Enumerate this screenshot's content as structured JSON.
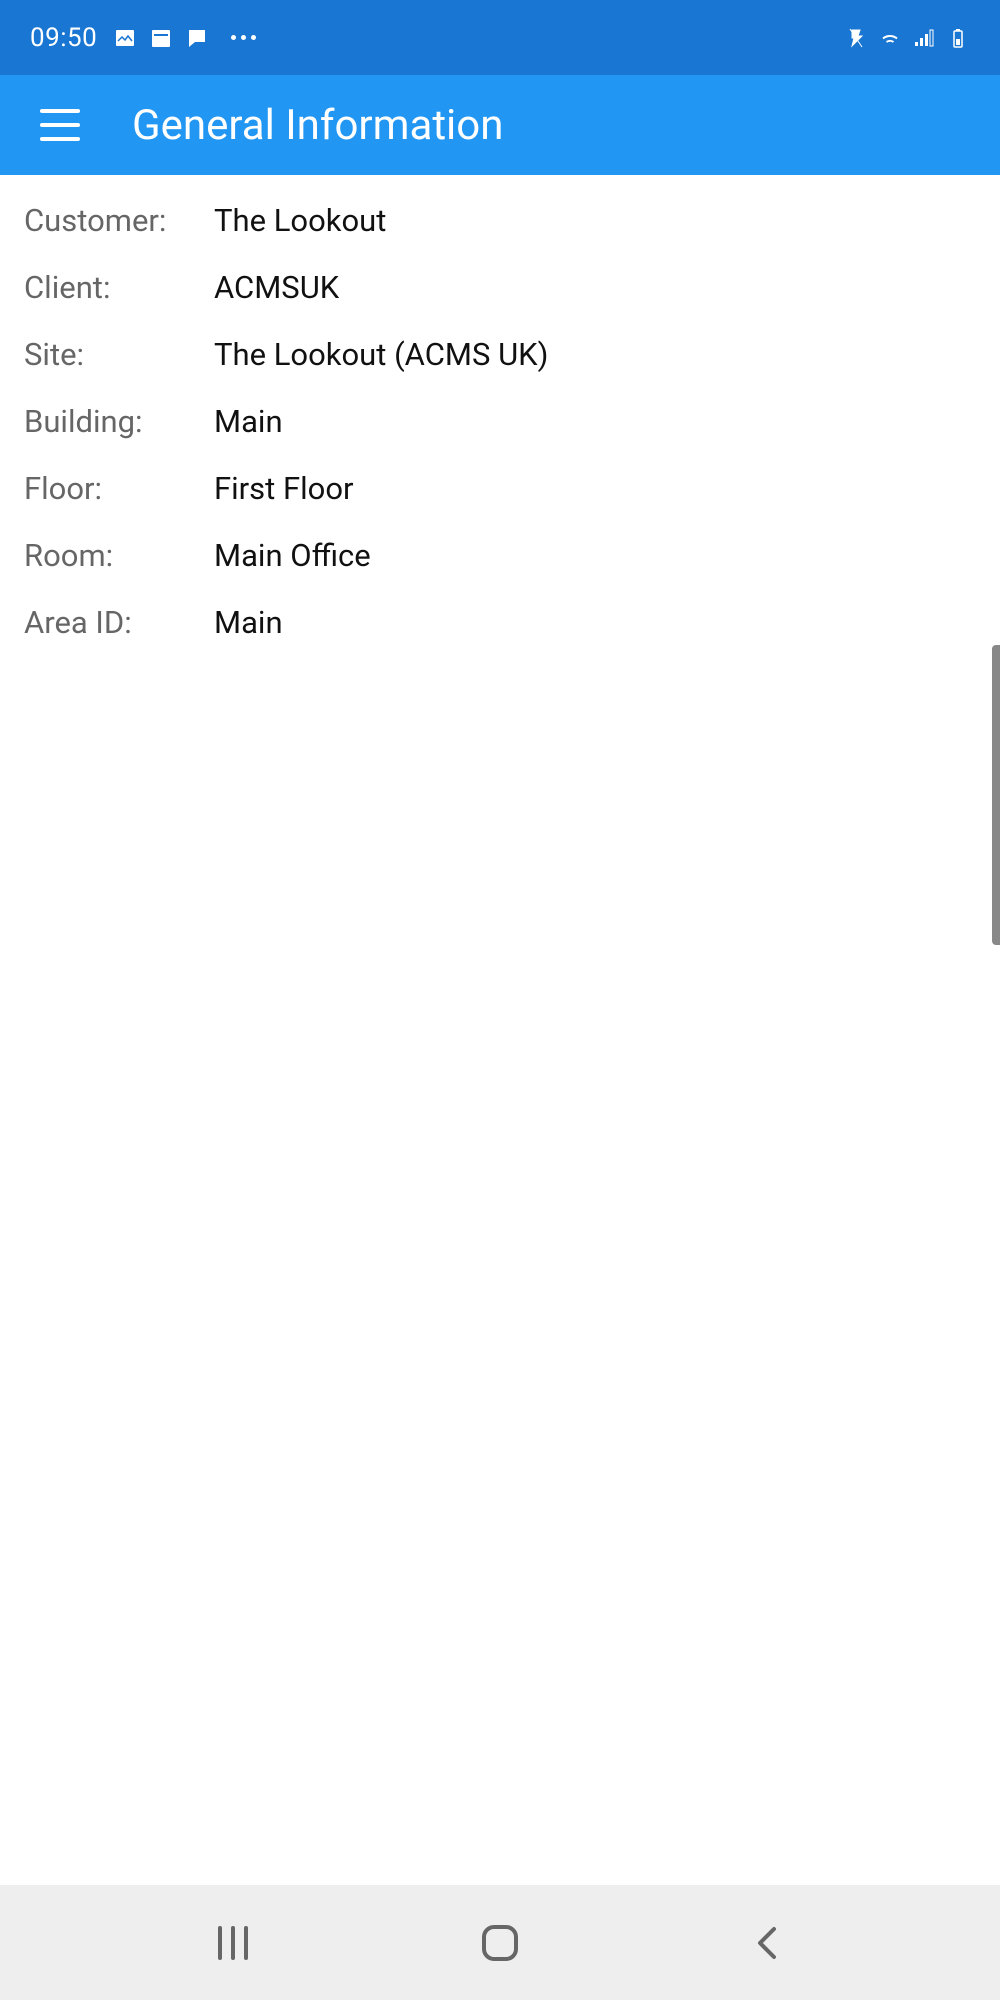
{
  "status_bar": {
    "time": "09:50"
  },
  "app_bar": {
    "title": "General Information"
  },
  "info": {
    "rows": [
      {
        "label": "Customer:",
        "value": "The Lookout"
      },
      {
        "label": "Client:",
        "value": "ACMSUK"
      },
      {
        "label": "Site:",
        "value": "The Lookout (ACMS UK)"
      },
      {
        "label": "Building:",
        "value": "Main"
      },
      {
        "label": "Floor:",
        "value": "First Floor"
      },
      {
        "label": "Room:",
        "value": "Main Office"
      },
      {
        "label": "Area ID:",
        "value": "Main"
      }
    ]
  }
}
